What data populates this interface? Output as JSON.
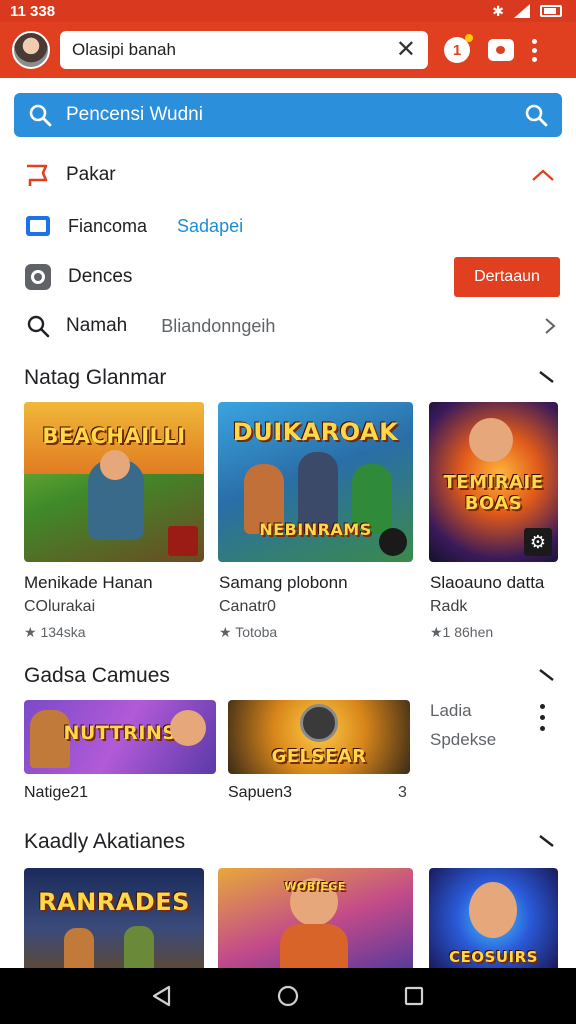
{
  "status_bar": {
    "time": "11 338"
  },
  "app_bar": {
    "search_value": "Olasipi banah",
    "notification_count": "1"
  },
  "search": {
    "placeholder": "Pencensi Wudni"
  },
  "menu": {
    "item1": {
      "label": "Pakar"
    },
    "item2": {
      "label": "Fiancoma",
      "sub": "Sadapei"
    },
    "item3": {
      "label": "Dences",
      "button": "Dertaaun"
    },
    "item4": {
      "label": "Namah",
      "sub": "Bliandonngeih"
    }
  },
  "section1": {
    "title": "Natag Glanmar",
    "cards": [
      {
        "art": "BEACHAILLI",
        "title": "Menikade Hanan",
        "sub": "COlurakai",
        "rating": "★ 134ska"
      },
      {
        "art": "DUIKAROAK",
        "art2": "NEBINRAMS",
        "title": "Samang plobonn",
        "sub": "Canatr0",
        "rating": "★ Totoba"
      },
      {
        "art": "TEMIRAIE BOAS",
        "title": "Slaoauno datta",
        "sub": "Radk",
        "rating": "★1 86hen"
      }
    ]
  },
  "section2": {
    "title": "Gadsa Camues",
    "cards": [
      {
        "art": "NUTTRINS",
        "title": "Natige21"
      },
      {
        "art": "GELSEAR",
        "title": "Sapuen3",
        "count": "3"
      }
    ],
    "side": {
      "line1": "Ladia",
      "line2": "Spdekse"
    }
  },
  "section3": {
    "title": "Kaadly Akatianes",
    "cards": [
      {
        "art": "RANRADES"
      },
      {
        "art": "WOBIEGE"
      },
      {
        "art": "CEOSUIRS"
      }
    ]
  },
  "colors": {
    "brand_red": "#e0401f",
    "search_blue": "#2b8fdb",
    "button_red": "#e0401f"
  }
}
